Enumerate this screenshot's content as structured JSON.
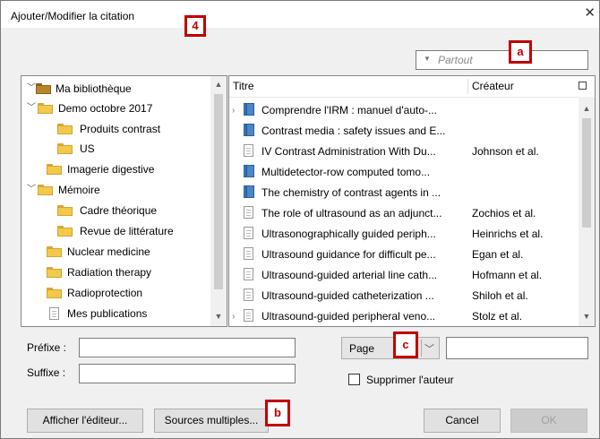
{
  "window": {
    "title": "Ajouter/Modifier la citation",
    "close_glyph": "✕"
  },
  "badges": {
    "four": "4",
    "a": "a",
    "b": "b",
    "c": "c",
    "color": "#c00000"
  },
  "search": {
    "placeholder": "Partout",
    "icon": "dropdown-triangle-icon"
  },
  "library": {
    "items": [
      {
        "label": "Ma bibliothèque",
        "icon": "library-icon",
        "expanded": true
      },
      {
        "label": "Demo octobre 2017",
        "icon": "folder-icon",
        "expanded": true
      },
      {
        "label": "Produits contrast",
        "icon": "folder-icon"
      },
      {
        "label": "US",
        "icon": "folder-icon"
      },
      {
        "label": "Imagerie digestive",
        "icon": "folder-icon"
      },
      {
        "label": "Mémoire",
        "icon": "folder-icon",
        "expanded": true
      },
      {
        "label": "Cadre théorique",
        "icon": "folder-icon"
      },
      {
        "label": "Revue de littérature",
        "icon": "folder-icon"
      },
      {
        "label": "Nuclear medicine",
        "icon": "folder-icon"
      },
      {
        "label": "Radiation therapy",
        "icon": "folder-icon"
      },
      {
        "label": "Radioprotection",
        "icon": "folder-icon"
      },
      {
        "label": "Mes publications",
        "icon": "document-icon"
      }
    ]
  },
  "items": {
    "columns": {
      "title": "Titre",
      "creator": "Créateur"
    },
    "rows": [
      {
        "title": "Comprendre l'IRM : manuel d'auto-...",
        "creator": "",
        "icon": "book-icon",
        "expander": true
      },
      {
        "title": "Contrast media : safety issues and E...",
        "creator": "",
        "icon": "book-icon"
      },
      {
        "title": "IV Contrast Administration With Du...",
        "creator": "Johnson et al.",
        "icon": "document-icon"
      },
      {
        "title": "Multidetector-row computed tomo...",
        "creator": "",
        "icon": "book-icon"
      },
      {
        "title": "The chemistry of contrast agents in ...",
        "creator": "",
        "icon": "book-icon"
      },
      {
        "title": "The role of ultrasound as an adjunct...",
        "creator": "Zochios et al.",
        "icon": "document-icon"
      },
      {
        "title": "Ultrasonographically guided periph...",
        "creator": "Heinrichs et al.",
        "icon": "document-icon"
      },
      {
        "title": "Ultrasound guidance for difficult pe...",
        "creator": "Egan et al.",
        "icon": "document-icon"
      },
      {
        "title": "Ultrasound-guided arterial line cath...",
        "creator": "Hofmann et al.",
        "icon": "document-icon"
      },
      {
        "title": "Ultrasound-guided catheterization ...",
        "creator": "Shiloh et al.",
        "icon": "document-icon"
      },
      {
        "title": "Ultrasound-guided peripheral veno...",
        "creator": "Stolz et al.",
        "icon": "document-icon",
        "expander": true
      }
    ]
  },
  "citation": {
    "prefix_label": "Préfixe :",
    "suffix_label": "Suffixe :",
    "prefix_value": "",
    "suffix_value": "",
    "locator_value": "Page",
    "locator_input_value": "",
    "suppress_author_label": "Supprimer l'auteur"
  },
  "buttons": {
    "editor": "Afficher l'éditeur...",
    "multiple": "Sources multiples...",
    "cancel": "Cancel",
    "ok": "OK"
  }
}
